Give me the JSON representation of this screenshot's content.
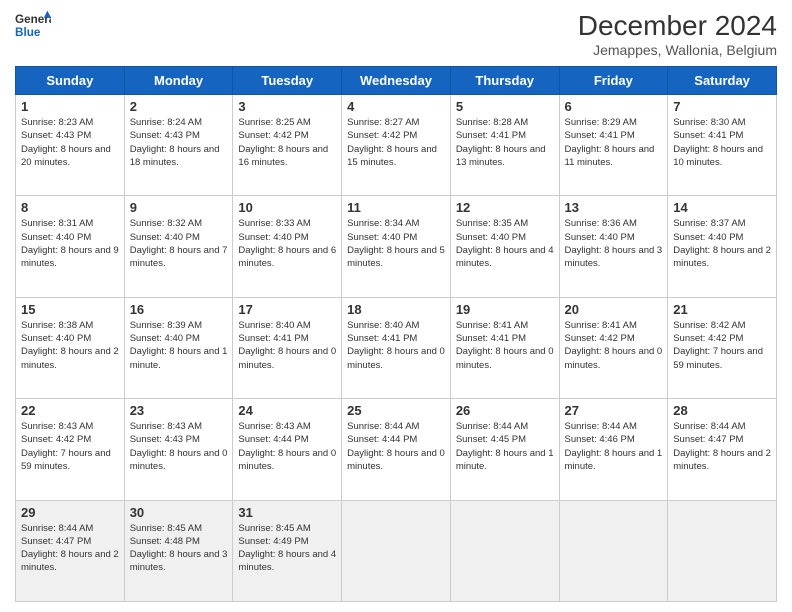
{
  "logo": {
    "line1": "General",
    "line2": "Blue"
  },
  "title": "December 2024",
  "subtitle": "Jemappes, Wallonia, Belgium",
  "weekdays": [
    "Sunday",
    "Monday",
    "Tuesday",
    "Wednesday",
    "Thursday",
    "Friday",
    "Saturday"
  ],
  "weeks": [
    [
      {
        "day": "1",
        "sunrise": "8:23 AM",
        "sunset": "4:43 PM",
        "daylight": "8 hours and 20 minutes."
      },
      {
        "day": "2",
        "sunrise": "8:24 AM",
        "sunset": "4:43 PM",
        "daylight": "8 hours and 18 minutes."
      },
      {
        "day": "3",
        "sunrise": "8:25 AM",
        "sunset": "4:42 PM",
        "daylight": "8 hours and 16 minutes."
      },
      {
        "day": "4",
        "sunrise": "8:27 AM",
        "sunset": "4:42 PM",
        "daylight": "8 hours and 15 minutes."
      },
      {
        "day": "5",
        "sunrise": "8:28 AM",
        "sunset": "4:41 PM",
        "daylight": "8 hours and 13 minutes."
      },
      {
        "day": "6",
        "sunrise": "8:29 AM",
        "sunset": "4:41 PM",
        "daylight": "8 hours and 11 minutes."
      },
      {
        "day": "7",
        "sunrise": "8:30 AM",
        "sunset": "4:41 PM",
        "daylight": "8 hours and 10 minutes."
      }
    ],
    [
      {
        "day": "8",
        "sunrise": "8:31 AM",
        "sunset": "4:40 PM",
        "daylight": "8 hours and 9 minutes."
      },
      {
        "day": "9",
        "sunrise": "8:32 AM",
        "sunset": "4:40 PM",
        "daylight": "8 hours and 7 minutes."
      },
      {
        "day": "10",
        "sunrise": "8:33 AM",
        "sunset": "4:40 PM",
        "daylight": "8 hours and 6 minutes."
      },
      {
        "day": "11",
        "sunrise": "8:34 AM",
        "sunset": "4:40 PM",
        "daylight": "8 hours and 5 minutes."
      },
      {
        "day": "12",
        "sunrise": "8:35 AM",
        "sunset": "4:40 PM",
        "daylight": "8 hours and 4 minutes."
      },
      {
        "day": "13",
        "sunrise": "8:36 AM",
        "sunset": "4:40 PM",
        "daylight": "8 hours and 3 minutes."
      },
      {
        "day": "14",
        "sunrise": "8:37 AM",
        "sunset": "4:40 PM",
        "daylight": "8 hours and 2 minutes."
      }
    ],
    [
      {
        "day": "15",
        "sunrise": "8:38 AM",
        "sunset": "4:40 PM",
        "daylight": "8 hours and 2 minutes."
      },
      {
        "day": "16",
        "sunrise": "8:39 AM",
        "sunset": "4:40 PM",
        "daylight": "8 hours and 1 minute."
      },
      {
        "day": "17",
        "sunrise": "8:40 AM",
        "sunset": "4:41 PM",
        "daylight": "8 hours and 0 minutes."
      },
      {
        "day": "18",
        "sunrise": "8:40 AM",
        "sunset": "4:41 PM",
        "daylight": "8 hours and 0 minutes."
      },
      {
        "day": "19",
        "sunrise": "8:41 AM",
        "sunset": "4:41 PM",
        "daylight": "8 hours and 0 minutes."
      },
      {
        "day": "20",
        "sunrise": "8:41 AM",
        "sunset": "4:42 PM",
        "daylight": "8 hours and 0 minutes."
      },
      {
        "day": "21",
        "sunrise": "8:42 AM",
        "sunset": "4:42 PM",
        "daylight": "7 hours and 59 minutes."
      }
    ],
    [
      {
        "day": "22",
        "sunrise": "8:43 AM",
        "sunset": "4:42 PM",
        "daylight": "7 hours and 59 minutes."
      },
      {
        "day": "23",
        "sunrise": "8:43 AM",
        "sunset": "4:43 PM",
        "daylight": "8 hours and 0 minutes."
      },
      {
        "day": "24",
        "sunrise": "8:43 AM",
        "sunset": "4:44 PM",
        "daylight": "8 hours and 0 minutes."
      },
      {
        "day": "25",
        "sunrise": "8:44 AM",
        "sunset": "4:44 PM",
        "daylight": "8 hours and 0 minutes."
      },
      {
        "day": "26",
        "sunrise": "8:44 AM",
        "sunset": "4:45 PM",
        "daylight": "8 hours and 1 minute."
      },
      {
        "day": "27",
        "sunrise": "8:44 AM",
        "sunset": "4:46 PM",
        "daylight": "8 hours and 1 minute."
      },
      {
        "day": "28",
        "sunrise": "8:44 AM",
        "sunset": "4:47 PM",
        "daylight": "8 hours and 2 minutes."
      }
    ],
    [
      {
        "day": "29",
        "sunrise": "8:44 AM",
        "sunset": "4:47 PM",
        "daylight": "8 hours and 2 minutes."
      },
      {
        "day": "30",
        "sunrise": "8:45 AM",
        "sunset": "4:48 PM",
        "daylight": "8 hours and 3 minutes."
      },
      {
        "day": "31",
        "sunrise": "8:45 AM",
        "sunset": "4:49 PM",
        "daylight": "8 hours and 4 minutes."
      },
      null,
      null,
      null,
      null
    ]
  ]
}
